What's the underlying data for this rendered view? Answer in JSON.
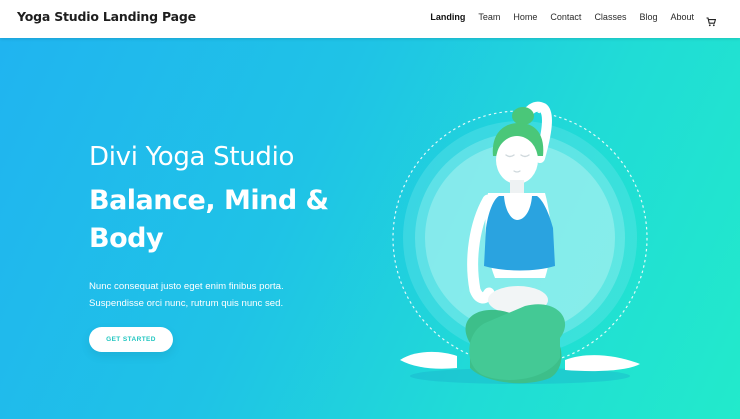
{
  "header": {
    "site_title": "Yoga Studio Landing Page",
    "nav": [
      "Landing",
      "Team",
      "Home",
      "Contact",
      "Classes",
      "Blog",
      "About"
    ],
    "active_nav": "Landing",
    "cart_icon": "cart-icon"
  },
  "hero": {
    "title": "Divi Yoga Studio",
    "headline": "Balance, Mind & Body",
    "body_line_1": "Nunc consequat justo eget enim finibus porta.",
    "body_line_2": "Suspendisse orci nunc, rutrum quis nunc sed.",
    "cta_label": "GET STARTED",
    "illustration": "yoga-woman-illustration"
  },
  "colors": {
    "gradient_start": "#20b4f0",
    "gradient_end": "#22eacb",
    "top_color": "#2aa3e0",
    "pants_color": "#3dbf8a",
    "hair_color": "#4ac779",
    "cta_text": "#20c6c0"
  }
}
